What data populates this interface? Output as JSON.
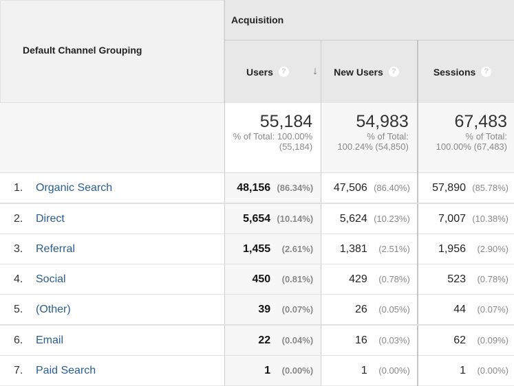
{
  "header": {
    "dimension_label": "Default Channel Grouping",
    "group_label": "Acquisition",
    "columns": [
      {
        "key": "users",
        "label": "Users",
        "help_icon": "question-icon",
        "sorted": "descending"
      },
      {
        "key": "new_users",
        "label": "New Users",
        "help_icon": "question-icon"
      },
      {
        "key": "sessions",
        "label": "Sessions",
        "help_icon": "question-icon"
      }
    ],
    "help_glyph": "?",
    "sort_glyph": "↓"
  },
  "totals": {
    "users": {
      "value": "55,184",
      "line1": "% of Total: 100.00%",
      "line2": "(55,184)"
    },
    "new_users": {
      "value": "54,983",
      "line1": "% of Total:",
      "line2": "100.24% (54,850)"
    },
    "sessions": {
      "value": "67,483",
      "line1": "% of Total:",
      "line2": "100.00% (67,483)"
    }
  },
  "rows": [
    {
      "index": "1.",
      "channel": "Organic Search",
      "users": "48,156",
      "users_pct": "(86.34%)",
      "new_users": "47,506",
      "new_users_pct": "(86.40%)",
      "sessions": "57,890",
      "sessions_pct": "(85.78%)"
    },
    {
      "index": "2.",
      "channel": "Direct",
      "users": "5,654",
      "users_pct": "(10.14%)",
      "new_users": "5,624",
      "new_users_pct": "(10.23%)",
      "sessions": "7,007",
      "sessions_pct": "(10.38%)"
    },
    {
      "index": "3.",
      "channel": "Referral",
      "users": "1,455",
      "users_pct": "(2.61%)",
      "new_users": "1,381",
      "new_users_pct": "(2.51%)",
      "sessions": "1,956",
      "sessions_pct": "(2.90%)"
    },
    {
      "index": "4.",
      "channel": "Social",
      "users": "450",
      "users_pct": "(0.81%)",
      "new_users": "429",
      "new_users_pct": "(0.78%)",
      "sessions": "523",
      "sessions_pct": "(0.78%)"
    },
    {
      "index": "5.",
      "channel": "(Other)",
      "users": "39",
      "users_pct": "(0.07%)",
      "new_users": "26",
      "new_users_pct": "(0.05%)",
      "sessions": "44",
      "sessions_pct": "(0.07%)"
    },
    {
      "index": "6.",
      "channel": "Email",
      "users": "22",
      "users_pct": "(0.04%)",
      "new_users": "16",
      "new_users_pct": "(0.03%)",
      "sessions": "62",
      "sessions_pct": "(0.09%)"
    },
    {
      "index": "7.",
      "channel": "Paid Search",
      "users": "1",
      "users_pct": "(0.00%)",
      "new_users": "1",
      "new_users_pct": "(0.00%)",
      "sessions": "1",
      "sessions_pct": "(0.00%)"
    }
  ]
}
